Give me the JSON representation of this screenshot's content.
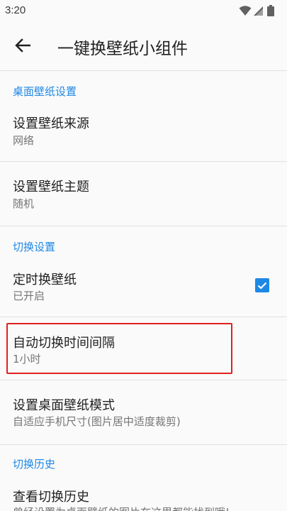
{
  "status_bar": {
    "time": "3:20",
    "icons": [
      "wifi-icon",
      "signal-icon",
      "battery-icon"
    ]
  },
  "app_bar": {
    "back_icon": "arrow-back-icon",
    "title": "一键换壁纸小组件"
  },
  "colors": {
    "accent": "#1e88e5",
    "highlight": "#e02020",
    "text_primary": "#212121",
    "text_secondary": "#757575"
  },
  "sections": [
    {
      "header": "桌面壁纸设置",
      "items": [
        {
          "title": "设置壁纸来源",
          "summary": "网络"
        },
        {
          "title": "设置壁纸主题",
          "summary": "随机"
        }
      ]
    },
    {
      "header": "切换设置",
      "items": [
        {
          "title": "定时换壁纸",
          "summary": "已开启",
          "checked": true
        },
        {
          "title": "自动切换时间间隔",
          "summary": "1小时",
          "highlighted": true
        },
        {
          "title": "设置桌面壁纸模式",
          "summary": "自适应手机尺寸(图片居中适度裁剪)"
        }
      ]
    },
    {
      "header": "切换历史",
      "items": [
        {
          "title": "查看切换历史",
          "summary": "曾经设置为桌面壁纸的图片在这里都能找到哦!"
        }
      ]
    }
  ]
}
